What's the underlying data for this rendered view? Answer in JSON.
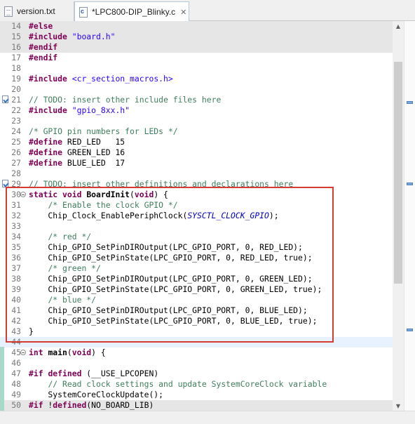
{
  "tabs": [
    {
      "label": "version.txt",
      "icon": "text-file-icon",
      "active": false
    },
    {
      "label": "*LPC800-DIP_Blinky.c",
      "icon": "c-file-icon",
      "active": true,
      "close": "✕"
    }
  ],
  "editor": {
    "lines": [
      {
        "n": "14",
        "hl": true,
        "tokens": [
          {
            "c": "pp",
            "t": "#else"
          }
        ]
      },
      {
        "n": "15",
        "hl": true,
        "tokens": [
          {
            "c": "pp",
            "t": "#include"
          },
          {
            "c": "",
            "t": " "
          },
          {
            "c": "str",
            "t": "\"board.h\""
          }
        ]
      },
      {
        "n": "16",
        "hl": true,
        "tokens": [
          {
            "c": "pp",
            "t": "#endif"
          }
        ]
      },
      {
        "n": "17",
        "tokens": [
          {
            "c": "pp",
            "t": "#endif"
          }
        ]
      },
      {
        "n": "18",
        "tokens": []
      },
      {
        "n": "19",
        "tokens": [
          {
            "c": "pp",
            "t": "#include"
          },
          {
            "c": "",
            "t": " "
          },
          {
            "c": "str",
            "t": "<cr_section_macros.h>"
          }
        ]
      },
      {
        "n": "20",
        "tokens": []
      },
      {
        "n": "21",
        "task": true,
        "tokens": [
          {
            "c": "cm",
            "t": "// TODO: insert other include files here"
          }
        ]
      },
      {
        "n": "22",
        "tokens": [
          {
            "c": "pp",
            "t": "#include"
          },
          {
            "c": "",
            "t": " "
          },
          {
            "c": "str",
            "t": "\"gpio_8xx.h\""
          }
        ]
      },
      {
        "n": "23",
        "tokens": []
      },
      {
        "n": "24",
        "tokens": [
          {
            "c": "cm",
            "t": "/* GPIO pin numbers for LEDs */"
          }
        ]
      },
      {
        "n": "25",
        "tokens": [
          {
            "c": "pp",
            "t": "#define"
          },
          {
            "c": "",
            "t": " RED_LED   15"
          }
        ]
      },
      {
        "n": "26",
        "tokens": [
          {
            "c": "pp",
            "t": "#define"
          },
          {
            "c": "",
            "t": " GREEN_LED 16"
          }
        ]
      },
      {
        "n": "27",
        "tokens": [
          {
            "c": "pp",
            "t": "#define"
          },
          {
            "c": "",
            "t": " BLUE_LED  17"
          }
        ]
      },
      {
        "n": "28",
        "tokens": []
      },
      {
        "n": "29",
        "task": true,
        "tokens": [
          {
            "c": "cm",
            "t": "// TODO: insert other definitions and declarations here"
          }
        ]
      },
      {
        "n": "30",
        "fold": true,
        "tokens": [
          {
            "c": "kw",
            "t": "static"
          },
          {
            "c": "",
            "t": " "
          },
          {
            "c": "kw",
            "t": "void"
          },
          {
            "c": "",
            "t": " "
          },
          {
            "c": "fn",
            "t": "BoardInit"
          },
          {
            "c": "",
            "t": "("
          },
          {
            "c": "kw",
            "t": "void"
          },
          {
            "c": "",
            "t": ") {"
          }
        ]
      },
      {
        "n": "31",
        "tokens": [
          {
            "c": "",
            "t": "    "
          },
          {
            "c": "cm",
            "t": "/* Enable the clock GPIO */"
          }
        ]
      },
      {
        "n": "32",
        "tokens": [
          {
            "c": "",
            "t": "    Chip_Clock_EnablePeriphClock("
          },
          {
            "c": "mac",
            "t": "SYSCTL_CLOCK_GPIO"
          },
          {
            "c": "",
            "t": ");"
          }
        ]
      },
      {
        "n": "33",
        "tokens": []
      },
      {
        "n": "34",
        "tokens": [
          {
            "c": "",
            "t": "    "
          },
          {
            "c": "cm",
            "t": "/* red */"
          }
        ]
      },
      {
        "n": "35",
        "tokens": [
          {
            "c": "",
            "t": "    Chip_GPIO_SetPinDIROutput(LPC_GPIO_PORT, 0, RED_LED);"
          }
        ]
      },
      {
        "n": "36",
        "tokens": [
          {
            "c": "",
            "t": "    Chip_GPIO_SetPinState(LPC_GPIO_PORT, 0, RED_LED, true);"
          }
        ]
      },
      {
        "n": "37",
        "tokens": [
          {
            "c": "",
            "t": "    "
          },
          {
            "c": "cm",
            "t": "/* green */"
          }
        ]
      },
      {
        "n": "38",
        "tokens": [
          {
            "c": "",
            "t": "    Chip_GPIO_SetPinDIROutput(LPC_GPIO_PORT, 0, GREEN_LED);"
          }
        ]
      },
      {
        "n": "39",
        "tokens": [
          {
            "c": "",
            "t": "    Chip_GPIO_SetPinState(LPC_GPIO_PORT, 0, GREEN_LED, true);"
          }
        ]
      },
      {
        "n": "40",
        "tokens": [
          {
            "c": "",
            "t": "    "
          },
          {
            "c": "cm",
            "t": "/* blue */"
          }
        ]
      },
      {
        "n": "41",
        "tokens": [
          {
            "c": "",
            "t": "    Chip_GPIO_SetPinDIROutput(LPC_GPIO_PORT, 0, BLUE_LED);"
          }
        ]
      },
      {
        "n": "42",
        "tokens": [
          {
            "c": "",
            "t": "    Chip_GPIO_SetPinState(LPC_GPIO_PORT, 0, BLUE_LED, true);"
          }
        ]
      },
      {
        "n": "43",
        "tokens": [
          {
            "c": "",
            "t": "}"
          }
        ]
      },
      {
        "n": "44",
        "cursor": true,
        "tokens": []
      },
      {
        "n": "45",
        "fold": true,
        "tokens": [
          {
            "c": "kw",
            "t": "int"
          },
          {
            "c": "",
            "t": " "
          },
          {
            "c": "fn",
            "t": "main"
          },
          {
            "c": "",
            "t": "("
          },
          {
            "c": "kw",
            "t": "void"
          },
          {
            "c": "",
            "t": ") {"
          }
        ]
      },
      {
        "n": "46",
        "tokens": []
      },
      {
        "n": "47",
        "tokens": [
          {
            "c": "pp",
            "t": "#if"
          },
          {
            "c": "",
            "t": " "
          },
          {
            "c": "kw",
            "t": "defined"
          },
          {
            "c": "",
            "t": " (__USE_LPCOPEN)"
          }
        ]
      },
      {
        "n": "48",
        "tokens": [
          {
            "c": "",
            "t": "    "
          },
          {
            "c": "cm",
            "t": "// Read clock settings and update SystemCoreClock variable"
          }
        ]
      },
      {
        "n": "49",
        "tokens": [
          {
            "c": "",
            "t": "    SystemCoreClockUpdate();"
          }
        ]
      },
      {
        "n": "50",
        "hl": true,
        "tokens": [
          {
            "c": "pp",
            "t": "#if"
          },
          {
            "c": "",
            "t": " !"
          },
          {
            "c": "kw",
            "t": "defined"
          },
          {
            "c": "",
            "t": "(NO_BOARD_LIB)"
          }
        ]
      }
    ]
  }
}
